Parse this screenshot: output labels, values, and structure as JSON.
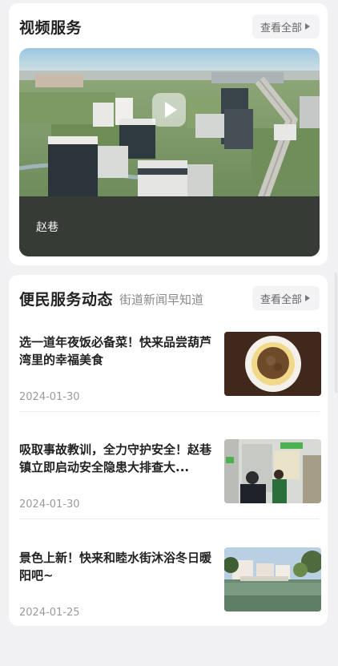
{
  "video_section": {
    "title": "视频服务",
    "view_all_label": "查看全部",
    "video": {
      "caption": "赵巷"
    }
  },
  "news_section": {
    "title": "便民服务动态",
    "subtitle": "街道新闻早知道",
    "view_all_label": "查看全部",
    "items": [
      {
        "title": "选一道年夜饭必备菜！快来品尝葫芦湾里的幸福美食",
        "date": "2024-01-30"
      },
      {
        "title": "吸取事故教训，全力守护安全！赵巷镇立即启动安全隐患大排查大...",
        "date": "2024-01-30"
      },
      {
        "title": "景色上新！快来和睦水街沐浴冬日暖阳吧~",
        "date": "2024-01-25"
      }
    ]
  }
}
